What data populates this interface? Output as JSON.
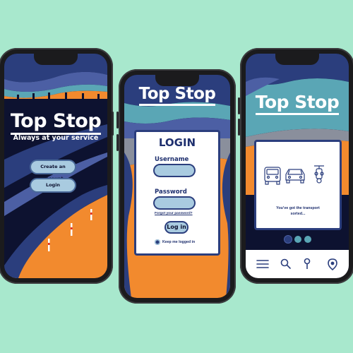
{
  "app": {
    "brand": "Top Stop"
  },
  "screen_welcome": {
    "tagline": "Always at your service",
    "create_account_label": "Create an account",
    "login_label": "Login"
  },
  "screen_login": {
    "heading": "LOGIN",
    "username_label": "Username",
    "password_label": "Password",
    "forgot_label": "Forgot your password?",
    "login_button_label": "Log in",
    "keep_logged_in_label": "Keep me logged in"
  },
  "screen_onboarding": {
    "message_line1": "You've got the transport",
    "message_line2": "sorted...",
    "pager": {
      "pages": 3,
      "active": 0
    },
    "nav_icons": [
      "menu-icon",
      "search-icon",
      "location-pin-icon",
      "favorite-pin-icon"
    ]
  },
  "colors": {
    "background": "#a8e8cd",
    "navy": "#0d1230",
    "blue": "#2b3e7d",
    "orange": "#f28a2e",
    "light_blue": "#a9cbe0",
    "sky": "#5aa6b5"
  }
}
